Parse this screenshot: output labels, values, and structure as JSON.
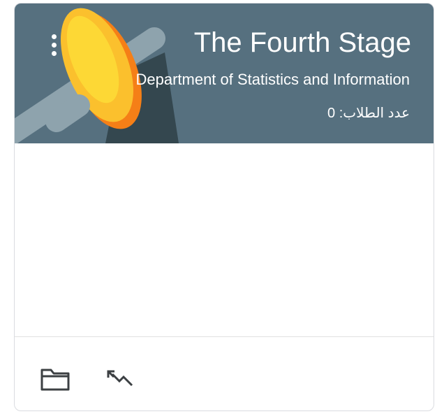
{
  "class_card": {
    "title": "The Fourth Stage",
    "subtitle": "Department of Statistics and Information",
    "students_label": "عدد الطلاب: 0",
    "header_color": "#56707f",
    "accent_color": "#fbc02d"
  },
  "icons": {
    "more": "more-vert-icon",
    "folder": "folder-icon",
    "trend": "trending-down-icon"
  }
}
